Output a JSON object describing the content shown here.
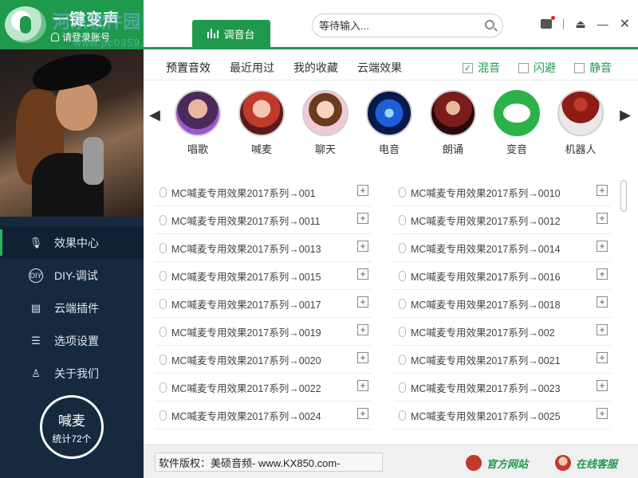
{
  "app": {
    "title": "一键变声",
    "login": "请登录账号",
    "watermark": "河东软件园",
    "watermark_url": "www.pc0359.cn"
  },
  "header": {
    "console_tab": "调音台",
    "search_placeholder": "等待输入..."
  },
  "sidebar": {
    "items": [
      {
        "label": "效果中心",
        "icon": "mic-icon"
      },
      {
        "label": "DIY-调试",
        "icon": "diy-icon"
      },
      {
        "label": "云端插件",
        "icon": "document-icon"
      },
      {
        "label": "选项设置",
        "icon": "sliders-icon"
      },
      {
        "label": "关于我们",
        "icon": "user-icon"
      }
    ],
    "stat_title": "喊麦",
    "stat_count": "统计72个"
  },
  "subtabs": [
    "预置音效",
    "最近用过",
    "我的收藏",
    "云端效果"
  ],
  "options": {
    "mix": {
      "label": "混音",
      "checked": true
    },
    "duck": {
      "label": "闪避",
      "checked": false
    },
    "mute": {
      "label": "静音",
      "checked": false
    }
  },
  "effects": [
    "唱歌",
    "喊麦",
    "聊天",
    "电音",
    "朗诵",
    "变音",
    "机器人"
  ],
  "list_left": [
    "MC喊麦专用效果2017系列→001",
    "MC喊麦专用效果2017系列→0011",
    "MC喊麦专用效果2017系列→0013",
    "MC喊麦专用效果2017系列→0015",
    "MC喊麦专用效果2017系列→0017",
    "MC喊麦专用效果2017系列→0019",
    "MC喊麦专用效果2017系列→0020",
    "MC喊麦专用效果2017系列→0022",
    "MC喊麦专用效果2017系列→0024"
  ],
  "list_right": [
    "MC喊麦专用效果2017系列→0010",
    "MC喊麦专用效果2017系列→0012",
    "MC喊麦专用效果2017系列→0014",
    "MC喊麦专用效果2017系列→0016",
    "MC喊麦专用效果2017系列→0018",
    "MC喊麦专用效果2017系列→002",
    "MC喊麦专用效果2017系列→0021",
    "MC喊麦专用效果2017系列→0023",
    "MC喊麦专用效果2017系列→0025"
  ],
  "footer": {
    "copyright": "软件版权：美硕音频- www.KX850.com-",
    "official_site": "官方网站",
    "online_service": "在线客服"
  },
  "colors": {
    "accent": "#1f9a4d",
    "sidebar": "#152a3f"
  }
}
